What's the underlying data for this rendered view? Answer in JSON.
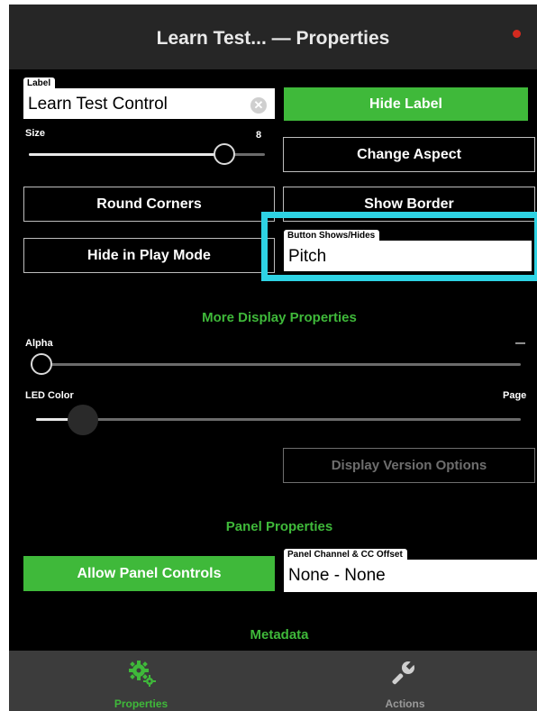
{
  "header": {
    "title": "Learn Test... — Properties"
  },
  "label_field": {
    "tag": "Label",
    "value": "Learn Test Control"
  },
  "size_slider": {
    "label": "Size",
    "value_text": "8",
    "fraction": 0.86
  },
  "buttons": {
    "hide_label": "Hide Label",
    "change_aspect": "Change Aspect",
    "round_corners": "Round Corners",
    "show_border": "Show Border",
    "hide_in_play_mode": "Hide in Play Mode",
    "display_version_options": "Display Version Options",
    "allow_panel_controls": "Allow Panel Controls"
  },
  "shows_hides_field": {
    "tag": "Button Shows/Hides",
    "value": "Pitch"
  },
  "sections": {
    "more_display": "More Display Properties",
    "panel": "Panel Properties",
    "metadata": "Metadata"
  },
  "alpha_slider": {
    "label": "Alpha",
    "value_text": "—",
    "fraction": 0.0
  },
  "led_slider": {
    "label": "LED Color",
    "value_text": "Page",
    "fraction": 0.07
  },
  "panel_channel_field": {
    "tag": "Panel Channel & CC Offset",
    "value": "None - None"
  },
  "tabs": [
    {
      "label": "Properties",
      "icon": "gears-icon",
      "active": true
    },
    {
      "label": "Actions",
      "icon": "wrench-icon",
      "active": false
    }
  ],
  "colors": {
    "accent": "#3fb93a",
    "highlight": "#2ed3e4",
    "record": "#d42a1f"
  }
}
